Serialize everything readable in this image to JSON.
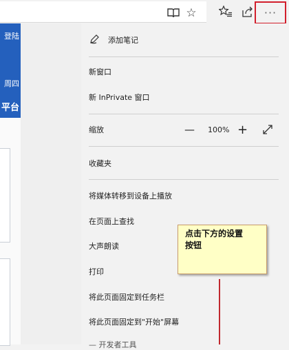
{
  "left_page": {
    "login_text": "登陆",
    "weekday_text": "周四",
    "platform_text": "平台"
  },
  "menu": {
    "items": [
      {
        "label": "添加笔记",
        "icon": "pen-icon"
      },
      {
        "label": "新窗口"
      },
      {
        "label": "新 InPrivate 窗口"
      },
      {
        "label": "缩放"
      },
      {
        "label": "收藏夹"
      },
      {
        "label": "将媒体转移到设备上播放"
      },
      {
        "label": "在页面上查找"
      },
      {
        "label": "大声朗读"
      },
      {
        "label": "打印"
      },
      {
        "label": "将此页面固定到任务栏"
      },
      {
        "label": "将此页面固定到\"开始\"屏幕"
      }
    ],
    "zoom_value": "100%",
    "zoom_minus": "—",
    "zoom_plus": "+",
    "fullscreen_glyph": "⤢",
    "bottom_partial": "— 开发者工具"
  },
  "toolbar": {
    "reading_view_glyph": "📖",
    "favorite_glyph": "☆",
    "favorites_list_glyph": "☆",
    "share_glyph": "⇪",
    "more_glyph": "···"
  },
  "callout": {
    "text_line1": "点击下方的设置",
    "text_line2": "按钮"
  },
  "colors": {
    "highlight": "#d21e2b",
    "callout_bg": "#ffffc6",
    "brand_blue": "#2460bd"
  }
}
